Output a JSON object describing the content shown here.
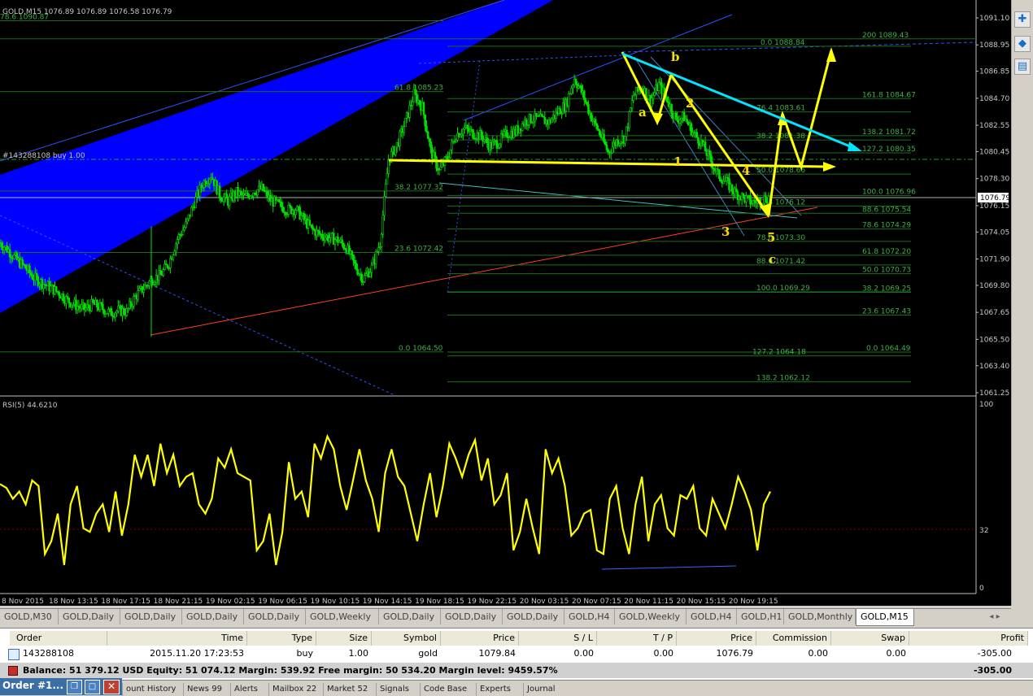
{
  "window": {
    "symbol_header": "GOLD,M15  1076.89 1076.89 1076.58 1076.79",
    "order_line_label": "#143288108 buy 1.00",
    "current_price_tag": "1076.79",
    "rsi_header": "RSI(5) 44.6210"
  },
  "colors": {
    "background": "#000000",
    "candles": "#00e000",
    "rsi_line": "#ffff00",
    "fib_text": "#3cb043",
    "channel_fill": "#0000ff",
    "cyan_trendline": "#00e5ff",
    "yellow_arrows": "#ffff00"
  },
  "chart_data": [
    {
      "type": "candlestick",
      "title": "GOLD,M15",
      "price_axis_ticks": [
        "1091.10",
        "1088.95",
        "1086.85",
        "1084.70",
        "1082.55",
        "1080.45",
        "1078.30",
        "1076.15",
        "1074.05",
        "1071.90",
        "1069.80",
        "1067.65",
        "1065.50",
        "1063.40",
        "1061.25"
      ],
      "ylim": [
        1061.25,
        1091.1
      ],
      "time_axis_ticks": [
        "8 Nov 2015",
        "18 Nov 13:15",
        "18 Nov 17:15",
        "18 Nov 21:15",
        "19 Nov 02:15",
        "19 Nov 06:15",
        "19 Nov 10:15",
        "19 Nov 14:15",
        "19 Nov 18:15",
        "19 Nov 22:15",
        "20 Nov 03:15",
        "20 Nov 07:15",
        "20 Nov 11:15",
        "20 Nov 15:15",
        "20 Nov 19:15"
      ],
      "close_path": [
        1073.2,
        1072.6,
        1071.8,
        1071.2,
        1070.4,
        1070.0,
        1069.6,
        1069.2,
        1068.6,
        1068.2,
        1067.9,
        1068.3,
        1068.0,
        1067.6,
        1067.8,
        1067.7,
        1068.9,
        1069.6,
        1070.3,
        1070.6,
        1071.6,
        1073.5,
        1074.6,
        1076.4,
        1077.9,
        1078.6,
        1077.0,
        1076.5,
        1077.2,
        1076.8,
        1077.3,
        1077.5,
        1076.6,
        1076.2,
        1075.8,
        1075.9,
        1075.0,
        1074.2,
        1073.8,
        1073.6,
        1073.4,
        1072.8,
        1071.4,
        1070.3,
        1071.2,
        1073.2,
        1079.8,
        1081.0,
        1082.8,
        1085.0,
        1084.0,
        1080.5,
        1078.9,
        1080.0,
        1081.8,
        1082.3,
        1081.9,
        1081.7,
        1080.9,
        1081.2,
        1081.9,
        1082.0,
        1082.8,
        1083.1,
        1083.0,
        1082.8,
        1083.6,
        1084.2,
        1086.3,
        1085.0,
        1083.2,
        1081.9,
        1080.4,
        1081.3,
        1081.6,
        1084.9,
        1085.6,
        1084.5,
        1085.8,
        1084.6,
        1083.0,
        1083.2,
        1082.0,
        1081.2,
        1079.9,
        1078.6,
        1078.0,
        1077.2,
        1076.8,
        1076.4,
        1076.6,
        1076.8
      ],
      "fib_levels": [
        {
          "label": "78.6  1090.87"
        },
        {
          "label": "200  1089.43"
        },
        {
          "label": "0.0  1088.84"
        },
        {
          "label": "61.8  1085.23"
        },
        {
          "label": "161.8  1084.67"
        },
        {
          "label": "76.4  1083.61"
        },
        {
          "label": "138.2  1081.72"
        },
        {
          "label": "38.2  1081.38"
        },
        {
          "label": "127.2  1080.35"
        },
        {
          "label": "38.2  1077.32"
        },
        {
          "label": "50.0  1078.66"
        },
        {
          "label": "100.0  1076.96"
        },
        {
          "label": "61.8  1076.12"
        },
        {
          "label": "88.6  1075.54"
        },
        {
          "label": "78.6  1074.29"
        },
        {
          "label": "78.6  1073.30"
        },
        {
          "label": "23.6  1072.42"
        },
        {
          "label": "61.8  1072.20"
        },
        {
          "label": "88.6  1071.42"
        },
        {
          "label": "50.0  1070.73"
        },
        {
          "label": "100.0  1069.29"
        },
        {
          "label": "38.2  1069.25"
        },
        {
          "label": "23.6  1067.43"
        },
        {
          "label": "0.0  1064.50"
        },
        {
          "label": "0.0  1064.49"
        },
        {
          "label": "127.2  1064.18"
        },
        {
          "label": "138.2  1062.12"
        }
      ],
      "wave_labels": [
        "a",
        "b",
        "1",
        "2",
        "3",
        "4",
        "5",
        "c"
      ]
    },
    {
      "type": "line",
      "title": "RSI(5) 44.6210",
      "ylim": [
        0,
        100
      ],
      "y_ticks": [
        "100",
        "32",
        "0"
      ],
      "level_line": 32,
      "values": [
        56,
        54,
        48,
        52,
        45,
        58,
        55,
        18,
        25,
        40,
        12,
        45,
        55,
        32,
        30,
        40,
        45,
        30,
        52,
        28,
        45,
        72,
        60,
        72,
        55,
        78,
        62,
        72,
        55,
        60,
        62,
        45,
        40,
        48,
        70,
        65,
        75,
        62,
        60,
        58,
        20,
        25,
        40,
        12,
        30,
        68,
        48,
        52,
        38,
        78,
        70,
        82,
        75,
        55,
        42,
        58,
        75,
        58,
        48,
        30,
        62,
        75,
        60,
        55,
        40,
        25,
        45,
        62,
        38,
        55,
        78,
        70,
        60,
        72,
        80,
        58,
        70,
        45,
        50,
        62,
        20,
        30,
        48,
        32,
        18,
        75,
        62,
        70,
        55,
        28,
        32,
        40,
        42,
        20,
        18,
        48,
        55,
        32,
        18,
        45,
        60,
        25,
        45,
        50,
        32,
        28,
        50,
        48,
        55,
        32,
        28,
        48,
        40,
        32,
        45,
        60,
        52,
        42,
        20,
        45,
        52
      ]
    }
  ],
  "chart_tabs": [
    {
      "label": "GOLD,M30"
    },
    {
      "label": "GOLD,Daily"
    },
    {
      "label": "GOLD,Daily"
    },
    {
      "label": "GOLD,Daily"
    },
    {
      "label": "GOLD,Daily"
    },
    {
      "label": "GOLD,Weekly"
    },
    {
      "label": "GOLD,Daily"
    },
    {
      "label": "GOLD,Daily"
    },
    {
      "label": "GOLD,Daily"
    },
    {
      "label": "GOLD,H4"
    },
    {
      "label": "GOLD,Weekly"
    },
    {
      "label": "GOLD,H4"
    },
    {
      "label": "GOLD,H1"
    },
    {
      "label": "GOLD,Monthly"
    },
    {
      "label": "GOLD,M15"
    }
  ],
  "tab_scroll": "◂  ▸",
  "terminal": {
    "headers": {
      "order": "Order",
      "time": "Time",
      "type": "Type",
      "size": "Size",
      "symbol": "Symbol",
      "price": "Price",
      "sl": "S / L",
      "tp": "T / P",
      "price2": "Price",
      "commission": "Commission",
      "swap": "Swap",
      "profit": "Profit"
    },
    "row": {
      "order": "143288108",
      "time": "2015.11.20 17:23:53",
      "type": "buy",
      "size": "1.00",
      "symbol": "gold",
      "price": "1079.84",
      "sl": "0.00",
      "tp": "0.00",
      "price2": "1076.79",
      "commission": "0.00",
      "swap": "0.00",
      "profit": "-305.00"
    },
    "balance_text": "Balance: 51 379.12 USD  Equity: 51 074.12  Margin: 539.92  Free margin: 50 534.20  Margin level: 9459.57%",
    "balance_profit": "-305.00"
  },
  "bottom_tabs": [
    "ount History",
    "News 99",
    "Alerts",
    "Mailbox 22",
    "Market 52",
    "Signals",
    "Code Base",
    "Experts",
    "Journal"
  ],
  "order_window_title": "Order #1..."
}
